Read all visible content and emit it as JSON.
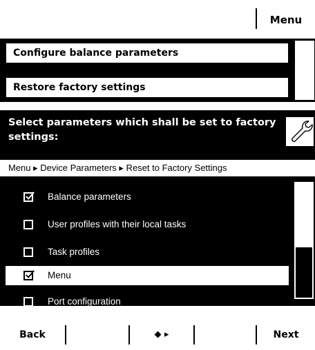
{
  "top_softkeys": {
    "right_label": "Menu"
  },
  "main_options": [
    {
      "label": "Configure balance parameters"
    },
    {
      "label": "Restore factory settings"
    }
  ],
  "dialog": {
    "title": "Select parameters which shall be set to factory settings:",
    "icon": "wrench-icon",
    "breadcrumb": "Menu ▸ Device Parameters ▸ Reset to Factory Settings",
    "items": [
      {
        "label": "Balance parameters",
        "checked": true,
        "selected": false
      },
      {
        "label": "User profiles with their local tasks",
        "checked": false,
        "selected": false
      },
      {
        "label": "Task profiles",
        "checked": false,
        "selected": false
      },
      {
        "label": "Menu",
        "checked": true,
        "selected": true
      },
      {
        "label": "Port configuration",
        "checked": false,
        "selected": false
      }
    ],
    "scroll_position_fraction": 0.56
  },
  "softkeys": {
    "back_label": "Back",
    "nav_label": "◆ ▸",
    "next_label": "Next"
  }
}
